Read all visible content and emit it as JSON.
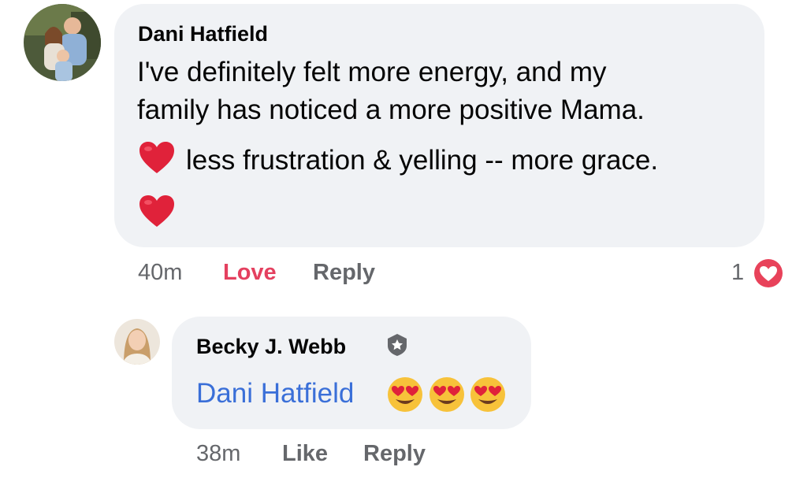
{
  "comment": {
    "author": "Dani Hatfield",
    "line1": "I've definitely felt more energy, and my",
    "line2": "family has noticed a more positive Mama.",
    "line3": "less frustration & yelling -- more grace.",
    "time": "40m",
    "love_label": "Love",
    "reply_label": "Reply",
    "reaction_count": "1",
    "heart_color": "#e0223a",
    "love_color": "#e4405f"
  },
  "reply": {
    "author": "Becky J. Webb",
    "mention": "Dani Hatfield",
    "emojis": [
      "heart-eyes-emoji",
      "heart-eyes-emoji",
      "heart-eyes-emoji"
    ],
    "time": "38m",
    "like_label": "Like",
    "reply_label": "Reply",
    "mention_color": "#3a6fd8"
  }
}
